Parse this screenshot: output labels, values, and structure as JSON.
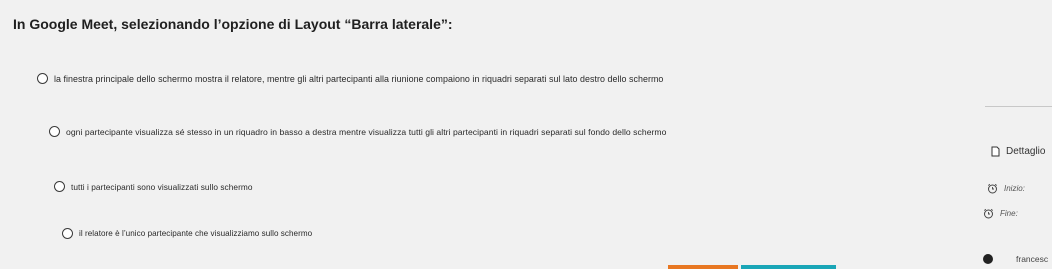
{
  "question": {
    "text": "In Google Meet, selezionando l’opzione di Layout “Barra laterale”:"
  },
  "options": [
    {
      "label": "la finestra principale dello schermo mostra il relatore, mentre gli altri partecipanti alla riunione compaiono in riquadri separati sul lato destro dello schermo"
    },
    {
      "label": "ogni partecipante visualizza sé stesso in un riquadro in basso a destra mentre visualizza tutti gli altri partecipanti in riquadri separati sul fondo dello schermo"
    },
    {
      "label": "tutti i partecipanti sono visualizzati sullo schermo"
    },
    {
      "label": "il relatore è l’unico partecipante che visualizziamo sullo schermo"
    }
  ],
  "sidebar": {
    "details_label": "Dettaglio",
    "start_label": "Inizio:",
    "end_label": "Fine:",
    "user_label": "francesc",
    "icons": {
      "details": "document-icon",
      "start": "alarm-clock-icon",
      "end": "alarm-clock-icon",
      "user": "avatar"
    }
  },
  "colors": {
    "background": "#f1f1f1",
    "progress_orange": "#e87722",
    "progress_teal": "#1aa6b7"
  }
}
